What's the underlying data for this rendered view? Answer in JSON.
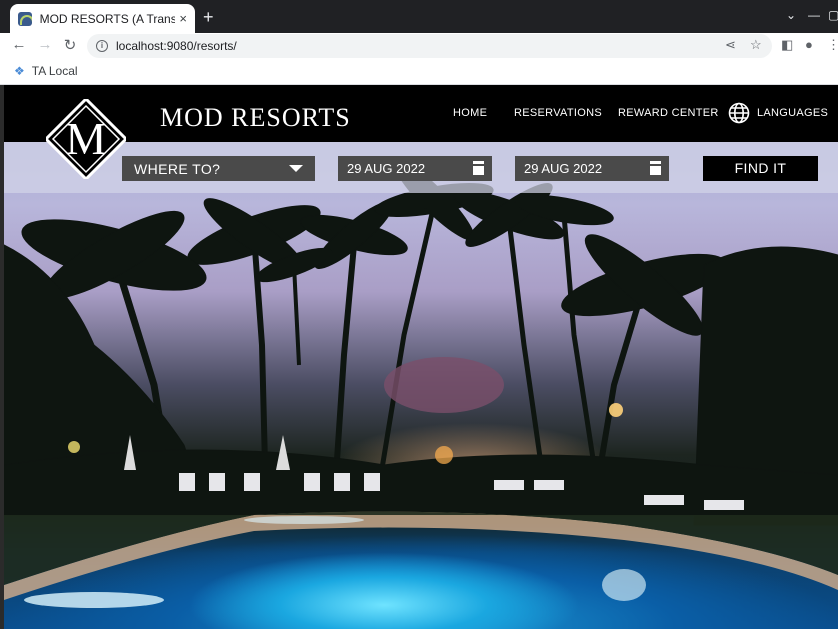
{
  "browser": {
    "tab_title": "MOD RESORTS (A Transfo",
    "tab_close": "×",
    "new_tab": "+",
    "url": "localhost:9080/resorts/",
    "bookmark_label": "TA Local"
  },
  "site": {
    "brand": "MOD RESORTS",
    "logo_letter": "M",
    "nav": {
      "home": "HOME",
      "reservations": "RESERVATIONS",
      "reward_center": "REWARD CENTER",
      "languages": "LANGUAGES"
    },
    "search": {
      "destination": "WHERE TO?",
      "checkin_date": "29 AUG 2022",
      "checkout_date": "29 AUG 2022",
      "submit_label": "FIND IT"
    }
  },
  "colors": {
    "header_bg": "#000000",
    "field_bg": "#4a4a4a",
    "strip_bg": "#d2d4e8"
  }
}
